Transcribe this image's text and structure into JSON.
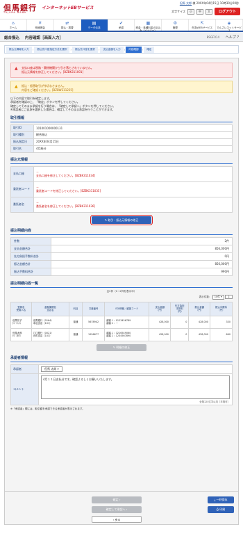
{
  "header": {
    "logo": "但馬銀行",
    "logo_sub": "TAJIMA BANK",
    "service": "インターネットEBサービス",
    "user_name": "但馬 太郎",
    "user_suffix": "様",
    "last_login": "20XX年04月15日 10時30分00秒",
    "size_label": "文字サイズ",
    "size_small": "小",
    "size_medium": "中",
    "size_large": "大",
    "logout": "ログアウト"
  },
  "nav": [
    {
      "icon": "⌂",
      "label": "ホーム"
    },
    {
      "icon": "¥",
      "label": "明細照会"
    },
    {
      "icon": "⇄",
      "label": "振込・振替"
    },
    {
      "icon": "▤",
      "label": "データ伝送"
    },
    {
      "icon": "✔",
      "label": "承認"
    },
    {
      "icon": "▦",
      "label": "税金・各種料金の払込み（ペイジー）"
    },
    {
      "icon": "⚙",
      "label": "管理"
    },
    {
      "icon": "⇱",
      "label": "外為WEBサービス"
    },
    {
      "icon": "◈",
      "label": "でんさいネットサービス"
    }
  ],
  "title": {
    "t1": "総合振込",
    "t2": "内容確認［画面入力］",
    "code": "BSGF014",
    "help": "ヘルプ"
  },
  "steps": [
    "振込元情報を入力",
    "振込先口座指定方法を選択",
    "振込先口座を選択",
    "支払金額を入力",
    "内容確認",
    "確定"
  ],
  "alerts": {
    "red": [
      "支払口座は税務・関係機関から引き落とされていません。",
      "振込元情報を修正してください。[BZBK311001]"
    ],
    "yellow": [
      "振込・振替取引が作切なさません。",
      "内容をご確認ください。[BZBW311225]"
    ]
  },
  "intro": [
    "以下の内容で取引を確定します。",
    "承認者を確認の上、「確定」ボタンを押してください。",
    "確定してそのまま承認を行う場合は、「確定して承認へ」ボタンを押してください。",
    "※承認者にご自身を選択した場合は、確定してそのまま承認を行うことができます。"
  ],
  "transaction": {
    "title": "取引情報",
    "rows": [
      {
        "k": "取引ID",
        "v": "101001000000131"
      },
      {
        "k": "取引種別",
        "v": "総合振込"
      },
      {
        "k": "振込指定日",
        "v": "20XX年04月15日"
      },
      {
        "k": "取引名",
        "v": "4月給分"
      }
    ]
  },
  "payer": {
    "title": "振込元情報",
    "rows": [
      {
        "k": "支払口座",
        "v1": "－",
        "v2": "支払口座を修正してください。[BZBK311034]"
      },
      {
        "k": "委託者コード",
        "v1": "－",
        "v2": "委託者コードを修正してください。[BZBK311035]"
      },
      {
        "k": "委託者名",
        "v1": "－",
        "v2": "委託者名を修正してください。[BZBK311036]"
      }
    ],
    "fix_button": "取引・振込元情報の修正"
  },
  "summary": {
    "title": "振込明細内容",
    "rows": [
      {
        "k": "件数",
        "v": "2件"
      },
      {
        "k": "支払金額合計",
        "v": "856,000円"
      },
      {
        "k": "先方負担手数料合計",
        "v": "0円"
      },
      {
        "k": "振込金額合計",
        "v": "856,000円"
      },
      {
        "k": "振込手数料合計",
        "v": "990円"
      }
    ]
  },
  "detail": {
    "title": "振込明細内容一覧",
    "meta": "全2件（1～2件を表示中）",
    "per_page_label": "表示件数：",
    "per_page": "10件",
    "headers": [
      "登録名\n受取人名",
      "金融機関名\n支店名",
      "科目",
      "口座番号",
      "EDI情報／顧客コード",
      "支払金額\n（円）",
      "先方負担\n手数料\n（円）",
      "振込金額\n（円）",
      "振込手数料\n（円）"
    ],
    "rows": [
      {
        "name": "但馬花子\nﾀｼﾞﾏﾊﾅｺ",
        "bank": "但馬銀行（0164）\n本店支店（101）",
        "type": "普通",
        "acct": "5678942",
        "edi": "顧客１：0123456789\n顧客２：－",
        "pay": "428,000",
        "fee_other": "0",
        "amount": "428,000",
        "fee": "330"
      },
      {
        "name": "但馬太郎\nﾀｼﾞﾏﾀﾛｳ",
        "bank": "〇〇銀行（0021）\n元町支店（103）",
        "type": "普通",
        "acct": "1956677",
        "edi": "顧客１：3216549060\n顧客２：1234567890",
        "pay": "428,000",
        "fee_other": "0",
        "amount": "428,000",
        "fee": "660"
      }
    ],
    "fix_button": "明細の修正"
  },
  "approver": {
    "title": "承認者情報",
    "approver_label": "承認者",
    "approver_value": "但馬 太郎",
    "comment_label": "コメント",
    "comment_value": "4月１１日支払分です。確認よろしくお願いいたします。",
    "limit": "全角120文字以内［半角可］"
  },
  "note": "※「承認者」欄には、取引額を承認できる承認者が表示されます。",
  "bottom": {
    "confirm": "確定",
    "confirm_approve": "確定して承認へ",
    "back": "戻る",
    "save": "一時保存",
    "print": "印刷"
  }
}
